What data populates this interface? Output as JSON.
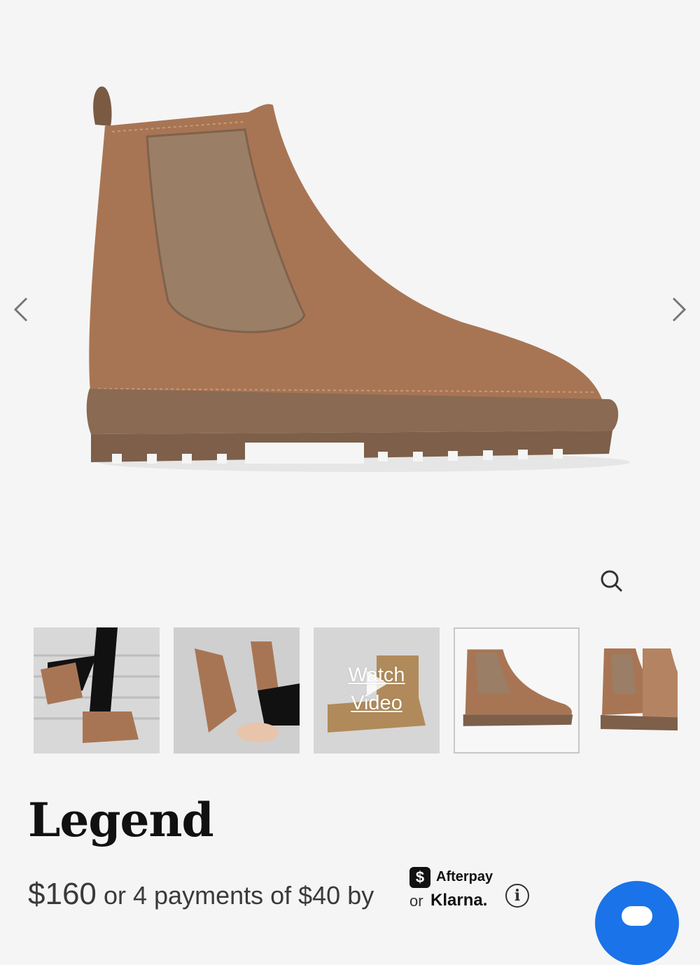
{
  "gallery": {
    "prev_icon": "chevron-left-icon",
    "next_icon": "chevron-right-icon",
    "zoom_icon": "magnifier-icon",
    "thumbnails": [
      {
        "kind": "photo",
        "alt": "lifestyle-stairs"
      },
      {
        "kind": "photo",
        "alt": "lifestyle-seated"
      },
      {
        "kind": "video",
        "label_line1": "Watch",
        "label_line2": "Video"
      },
      {
        "kind": "photo",
        "alt": "side-view",
        "selected": true
      },
      {
        "kind": "photo",
        "alt": "pair-view"
      }
    ]
  },
  "product": {
    "title": "Legend",
    "price": "$160",
    "installments_text": "or 4 payments of $40 by",
    "afterpay_badge": "$",
    "afterpay_label": "Afterpay",
    "klarna_or": "or",
    "klarna_label": "Klarna.",
    "info_glyph": "i"
  },
  "colors": {
    "boot_leather": "#a87554",
    "boot_sole": "#8a6a52",
    "elastic": "#9a7e66",
    "chat_fab": "#1a73e8"
  }
}
